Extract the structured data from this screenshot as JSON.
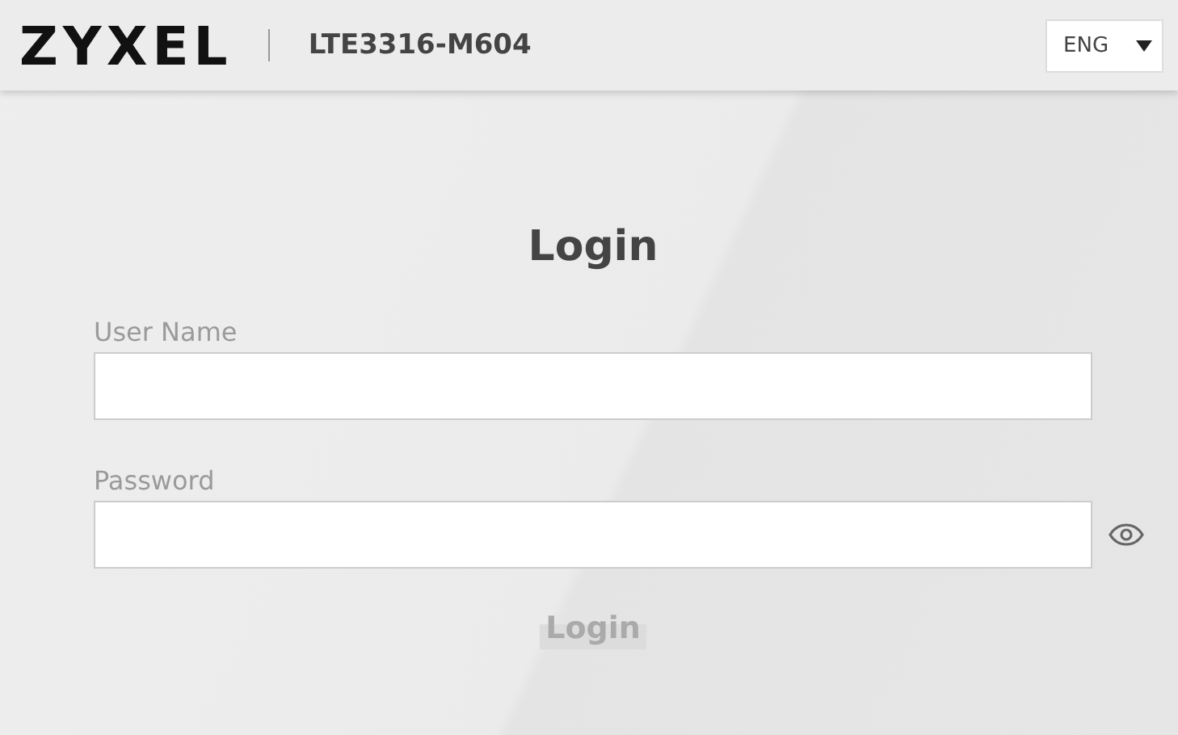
{
  "header": {
    "logo": "ZYXEL",
    "model": "LTE3316-M604",
    "language": "ENG"
  },
  "login": {
    "title": "Login",
    "fields": [
      {
        "label": "User Name",
        "kind": "text"
      },
      {
        "label": "Password",
        "kind": "password"
      }
    ],
    "button": {
      "label": "Login",
      "disabled": true
    }
  }
}
